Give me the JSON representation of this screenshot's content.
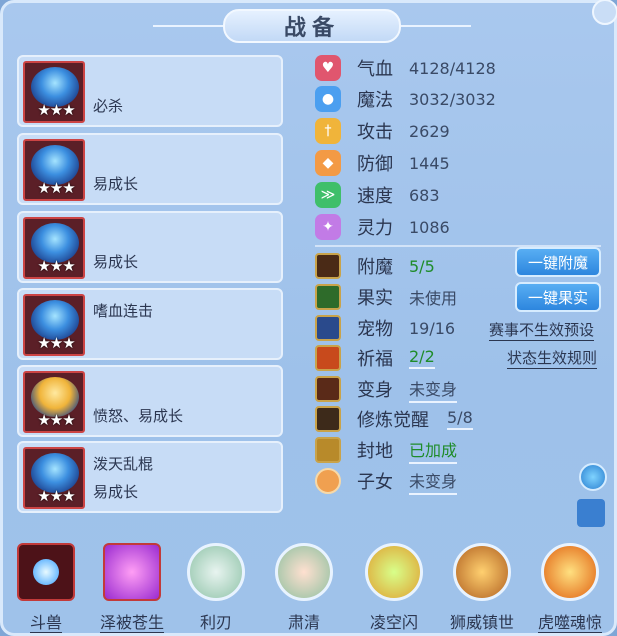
{
  "title": "战备",
  "skills": [
    {
      "line1": "",
      "line2": "必杀",
      "stars": "★★★"
    },
    {
      "line1": "",
      "line2": "易成长",
      "stars": "★★★"
    },
    {
      "line1": "",
      "line2": "易成长",
      "stars": "★★★"
    },
    {
      "line1": "嗜血连击",
      "line2": "",
      "stars": "★★★"
    },
    {
      "line1": "",
      "line2": "愤怒、易成长",
      "stars": "★★★"
    },
    {
      "line1": "泼天乱棍",
      "line2": "易成长",
      "stars": "★★★"
    }
  ],
  "stats": [
    {
      "name": "气血",
      "value": "4128/4128",
      "icon": "heart-icon",
      "color": "#e0566e"
    },
    {
      "name": "魔法",
      "value": "3032/3032",
      "icon": "mana-icon",
      "color": "#4b9ff0"
    },
    {
      "name": "攻击",
      "value": "2629",
      "icon": "sword-icon",
      "color": "#f0b43a"
    },
    {
      "name": "防御",
      "value": "1445",
      "icon": "shield-icon",
      "color": "#f39a45"
    },
    {
      "name": "速度",
      "value": "683",
      "icon": "speed-icon",
      "color": "#3fbf6a"
    },
    {
      "name": "灵力",
      "value": "1086",
      "icon": "spirit-icon",
      "color": "#c27be6"
    }
  ],
  "rows": [
    {
      "name": "附魔",
      "value": "5/5",
      "green": true,
      "underline": false,
      "icon": "enchant-icon"
    },
    {
      "name": "果实",
      "value": "未使用",
      "green": false,
      "underline": false,
      "icon": "fruit-icon"
    },
    {
      "name": "宠物",
      "value": "19/16",
      "green": false,
      "underline": false,
      "icon": "pet-icon"
    },
    {
      "name": "祈福",
      "value": "2/2",
      "green": true,
      "underline": true,
      "icon": "blessing-icon"
    },
    {
      "name": "变身",
      "value": "未变身",
      "green": false,
      "underline": true,
      "icon": "transform-icon"
    },
    {
      "name": "修炼觉醒",
      "value": "5/8",
      "green": false,
      "underline": true,
      "icon": "cultivation-icon"
    },
    {
      "name": "封地",
      "value": "已加成",
      "green": true,
      "underline": true,
      "icon": "fief-icon"
    },
    {
      "name": "子女",
      "value": "未变身",
      "green": false,
      "underline": true,
      "icon": "children-icon"
    }
  ],
  "buttons": {
    "enchant": "一键附魔",
    "fruit": "一键果实"
  },
  "links": {
    "event": "赛事不生效预设",
    "status": "状态生效规则"
  },
  "bottom_skills": [
    {
      "label": "斗兽",
      "underline": true,
      "shape": "square",
      "icon": "beast-fight-icon"
    },
    {
      "label": "泽被苍生",
      "underline": true,
      "shape": "square",
      "icon": "blessing-hand-icon"
    },
    {
      "label": "利刃",
      "underline": false,
      "shape": "round",
      "icon": "blade-icon"
    },
    {
      "label": "肃清",
      "underline": false,
      "shape": "round",
      "icon": "purge-icon"
    },
    {
      "label": "凌空闪",
      "underline": false,
      "shape": "round",
      "icon": "flash-icon"
    },
    {
      "label": "狮威镇世",
      "underline": false,
      "shape": "round",
      "icon": "lion-icon"
    },
    {
      "label": "虎噬魂惊",
      "underline": true,
      "shape": "round",
      "icon": "tiger-icon"
    }
  ]
}
